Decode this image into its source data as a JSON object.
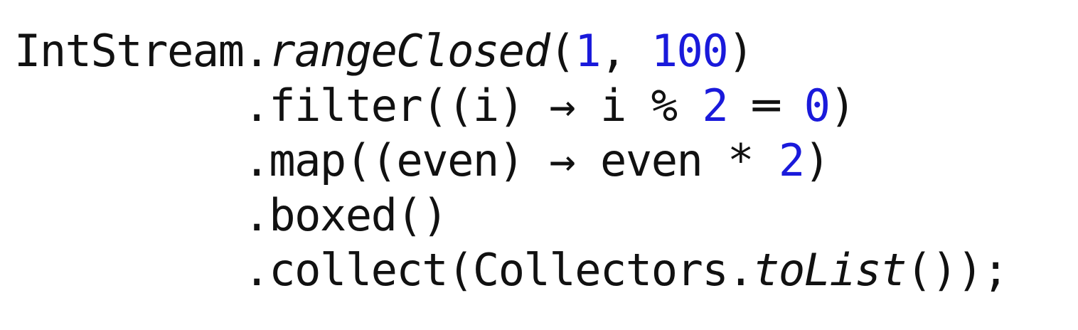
{
  "code": {
    "line1": {
      "class_name": "IntStream",
      "dot": ".",
      "method": "rangeClosed",
      "open_paren": "(",
      "arg1": "1",
      "comma": ", ",
      "arg2": "100",
      "close_paren": ")"
    },
    "line2": {
      "indent": "         ",
      "text": ".filter((i) → i % ",
      "num1": "2",
      "mid": " ═ ",
      "num2": "0",
      "close": ")"
    },
    "line3": {
      "indent": "         ",
      "text": ".map((even) → even * ",
      "num": "2",
      "close": ")"
    },
    "line4": {
      "indent": "         ",
      "text": ".boxed()"
    },
    "line5": {
      "indent": "         ",
      "text": ".collect(Collectors.",
      "method": "toList",
      "close": "());"
    },
    "colors": {
      "text": "#111111",
      "number": "#1a1adb",
      "background": "#ffffff"
    }
  }
}
